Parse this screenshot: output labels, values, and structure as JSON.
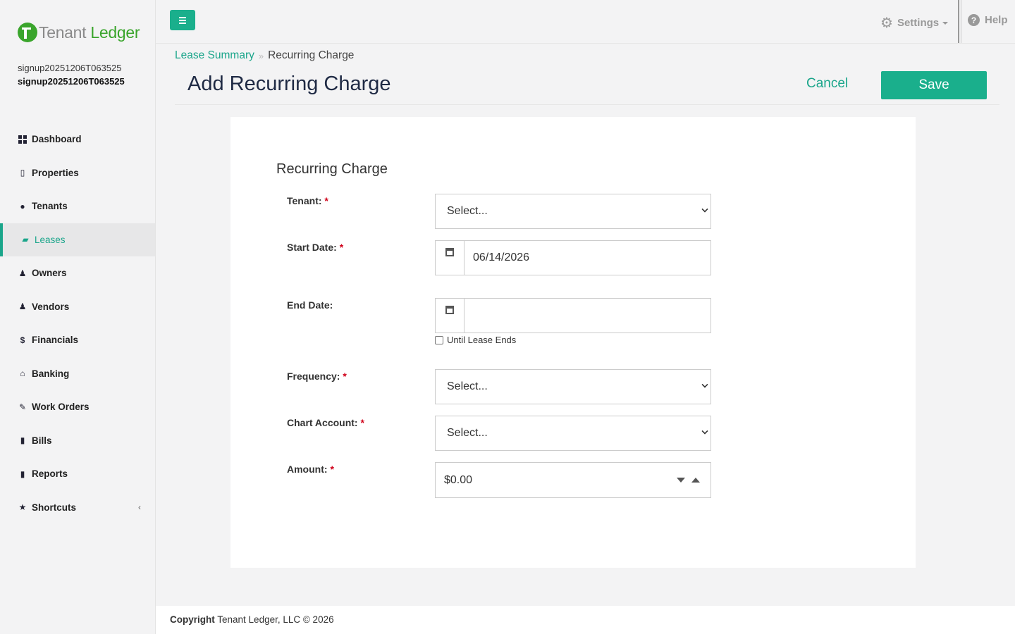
{
  "brand": {
    "name_part1": "Tenant",
    "name_part2": "Ledger"
  },
  "user": {
    "line1": "signup20251206T063525",
    "line2": "signup20251206T063525"
  },
  "nav": [
    {
      "label": "Dashboard",
      "icon": "dashboard-icon"
    },
    {
      "label": "Properties",
      "icon": "building-icon"
    },
    {
      "label": "Tenants",
      "icon": "user-icon"
    },
    {
      "label": "Leases",
      "icon": "folder-open-icon",
      "active": true
    },
    {
      "label": "Owners",
      "icon": "users-icon"
    },
    {
      "label": "Vendors",
      "icon": "users-icon"
    },
    {
      "label": "Financials",
      "icon": "dollar-icon"
    },
    {
      "label": "Banking",
      "icon": "bank-icon"
    },
    {
      "label": "Work Orders",
      "icon": "edit-icon"
    },
    {
      "label": "Bills",
      "icon": "file-icon"
    },
    {
      "label": "Reports",
      "icon": "file-icon"
    },
    {
      "label": "Shortcuts",
      "icon": "star-icon"
    }
  ],
  "topbar": {
    "settings_label": "Settings",
    "help_label": "Help"
  },
  "breadcrumb": {
    "parent": "Lease Summary",
    "current": "Recurring Charge"
  },
  "page": {
    "title": "Add Recurring Charge",
    "cancel_label": "Cancel",
    "save_label": "Save"
  },
  "form": {
    "section_title": "Recurring Charge",
    "tenant": {
      "label": "Tenant:",
      "value": "Select..."
    },
    "start_date": {
      "label": "Start Date:",
      "value": "06/14/2026"
    },
    "end_date": {
      "label": "End Date:",
      "value": "",
      "checkbox_label": "Until Lease Ends"
    },
    "frequency": {
      "label": "Frequency:",
      "value": "Select..."
    },
    "chart_account": {
      "label": "Chart Account:",
      "value": "Select..."
    },
    "amount": {
      "label": "Amount:",
      "value": "$0.00"
    },
    "required_mark": "*"
  },
  "footer": {
    "bold": "Copyright",
    "text": "Tenant Ledger, LLC © 2026"
  },
  "colors": {
    "accent": "#1aaf8c",
    "brand_green": "#3aa52c",
    "required": "#d0021b"
  }
}
